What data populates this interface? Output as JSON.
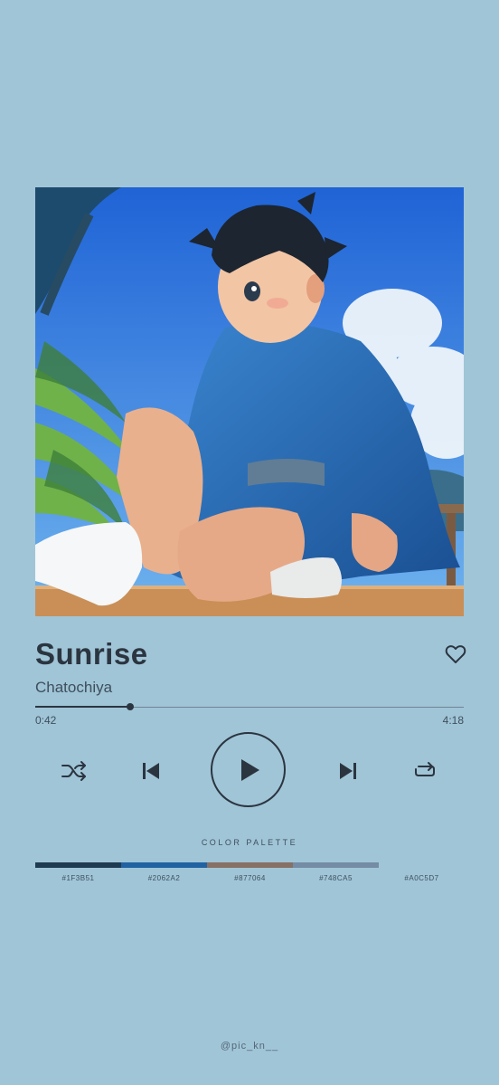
{
  "album_art": {
    "icon": "anime-boy-illustration",
    "sky_top": "#1f63d6",
    "sky_bottom": "#6fb3ee",
    "robe_color": "#2062A2"
  },
  "track": {
    "title": "Sunrise",
    "artist": "Chatochiya",
    "elapsed": "0:42",
    "duration": "4:18",
    "progress": 0.222
  },
  "icons": {
    "like": "heart-outline-icon",
    "shuffle": "shuffle-icon",
    "previous": "skip-previous-icon",
    "play": "play-icon",
    "next": "skip-next-icon",
    "repeat": "repeat-icon"
  },
  "palette": {
    "title": "COLOR PALETTE",
    "colors": [
      {
        "hex": "#1F3B51",
        "label": "#1F3B51"
      },
      {
        "hex": "#2062A2",
        "label": "#2062A2"
      },
      {
        "hex": "#877064",
        "label": "#877064"
      },
      {
        "hex": "#748CA5",
        "label": "#748CA5"
      },
      {
        "hex": "#A0C5D7",
        "label": "#A0C5D7"
      }
    ]
  },
  "credit": "@pic_kn__",
  "colors": {
    "background": "#A0C5D7",
    "foreground": "#2b3540"
  }
}
